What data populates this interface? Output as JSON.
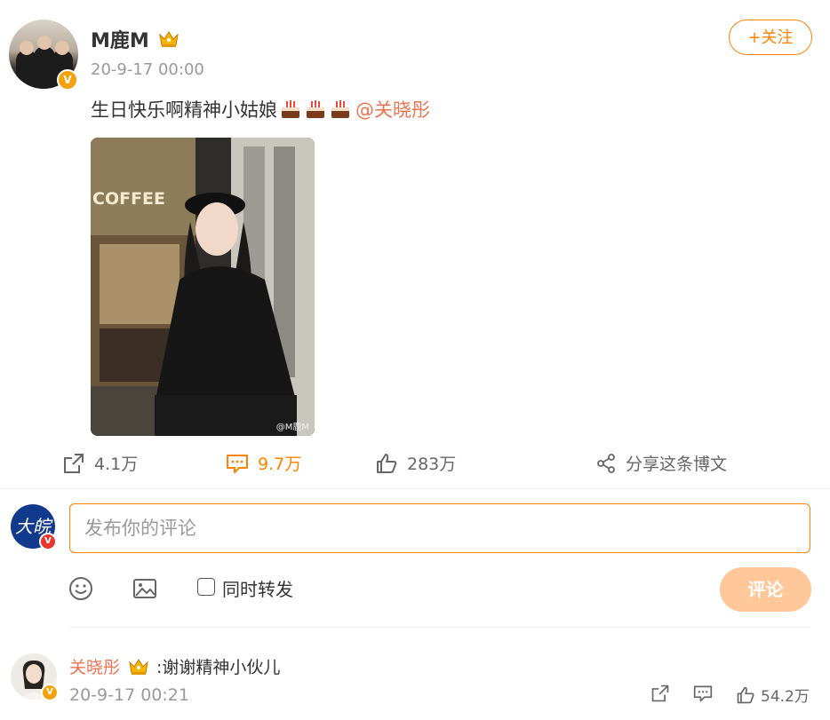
{
  "post": {
    "author": "M鹿M",
    "timestamp": "20-9-17 00:00",
    "follow_label": "+关注",
    "text": "生日快乐啊精神小姑娘",
    "mention": "@关晓彤",
    "image_alt": "Woman in black cap and black coat in front of COFFEE shop at night",
    "image_sign": "COFFEE",
    "watermark": "@M鹿M",
    "actions": {
      "forward": "4.1万",
      "comments": "9.7万",
      "likes": "283万",
      "share": "分享这条博文"
    }
  },
  "composer": {
    "placeholder": "发布你的评论",
    "avatar_text": "大皖",
    "sync_label": "同时转发",
    "submit_label": "评论"
  },
  "reply": {
    "author": "关晓彤",
    "text": ":谢谢精神小伙儿",
    "timestamp": "20-9-17 00:21",
    "likes": "54.2万"
  },
  "colors": {
    "accent": "#ff8200",
    "mention": "#eb7350",
    "submit_disabled": "#ffc89a",
    "verified_badge": "#f4a20c"
  },
  "icons": [
    "forward-icon",
    "comment-icon",
    "like-icon",
    "share-icon",
    "emoji-icon",
    "image-icon",
    "crown-icon",
    "verified-icon",
    "cake-icon"
  ]
}
